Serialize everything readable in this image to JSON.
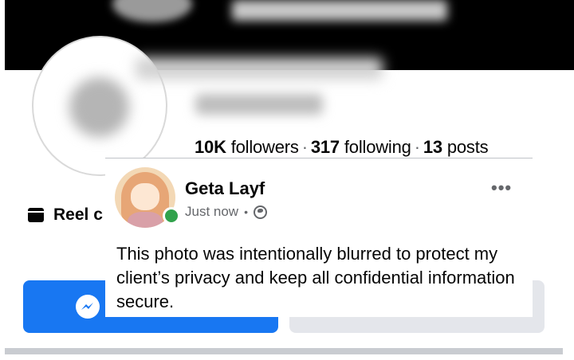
{
  "profile": {
    "stats": {
      "followers_count": "10K",
      "followers_label": "followers",
      "following_count": "317",
      "following_label": "following",
      "posts_count": "13",
      "posts_label": "posts",
      "separator": "·"
    },
    "reel_label": "Reel c"
  },
  "post": {
    "author": "Geta Layf",
    "time": "Just now",
    "meta_separator": "•",
    "audience_icon": "globe-icon",
    "more_label": "•••",
    "text": "This photo was intentionally blurred to protect my client’s privacy and keep all confidential information secure."
  },
  "colors": {
    "primary_button": "#1877f2",
    "online_status": "#31a24c",
    "secondary_button": "#e4e6eb"
  }
}
